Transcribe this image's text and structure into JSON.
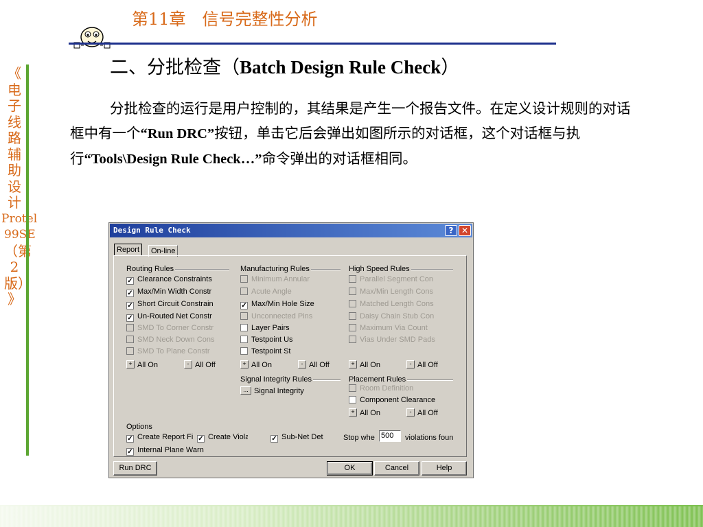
{
  "slide": {
    "chapter_title": "第11章　信号完整性分析",
    "side_title": [
      "《",
      "电",
      "子",
      "线",
      "路",
      "辅",
      "助",
      "设",
      "计",
      "Protel",
      "99SE",
      "（第",
      "2",
      "版）",
      "》"
    ],
    "heading_prefix": "二、分批检查（",
    "heading_en": "Batch Design Rule Check",
    "heading_suffix": "）",
    "para": {
      "p1": "分批检查的运行是用户控制的，其结果是产生一个报告文件。在定义设计规则的对话框中有一个",
      "q1": "“Run DRC”",
      "p2": "按钮，单击它后会弹出如图所示的对话框，这个对话框与执行",
      "q2": "“Tools\\Design Rule Check…”",
      "p3": "命令弹出的对话框相同。"
    }
  },
  "dialog": {
    "title": "Design Rule Check",
    "help_glyph": "?",
    "close_glyph": "✕",
    "tabs": [
      "Report",
      "On-line"
    ],
    "routing": {
      "label": "Routing Rules",
      "items": [
        {
          "label": "Clearance Constraints",
          "checked": true,
          "enabled": true
        },
        {
          "label": "Max/Min Width Constr",
          "checked": true,
          "enabled": true
        },
        {
          "label": "Short Circuit Constrain",
          "checked": true,
          "enabled": true
        },
        {
          "label": "Un-Routed Net Constr",
          "checked": true,
          "enabled": true
        },
        {
          "label": "SMD To Corner Constr",
          "checked": false,
          "enabled": false
        },
        {
          "label": "SMD Neck Down Cons",
          "checked": false,
          "enabled": false
        },
        {
          "label": "SMD To Plane Constr",
          "checked": false,
          "enabled": false
        }
      ]
    },
    "manufacturing": {
      "label": "Manufacturing Rules",
      "items": [
        {
          "label": "Minimum Annular",
          "checked": false,
          "enabled": false
        },
        {
          "label": "Acute Angle",
          "checked": false,
          "enabled": false
        },
        {
          "label": "Max/Min Hole Size",
          "checked": true,
          "enabled": true
        },
        {
          "label": "Unconnected Pins",
          "checked": false,
          "enabled": false
        },
        {
          "label": "Layer Pairs",
          "checked": false,
          "enabled": true
        },
        {
          "label": "Testpoint Us",
          "checked": false,
          "enabled": true
        },
        {
          "label": "Testpoint St",
          "checked": false,
          "enabled": true
        }
      ]
    },
    "high_speed": {
      "label": "High Speed Rules",
      "items": [
        {
          "label": "Parallel Segment Con",
          "checked": false,
          "enabled": false
        },
        {
          "label": "Max/Min Length Cons",
          "checked": false,
          "enabled": false
        },
        {
          "label": "Matched Length Cons",
          "checked": false,
          "enabled": false
        },
        {
          "label": "Daisy Chain Stub Con",
          "checked": false,
          "enabled": false
        },
        {
          "label": "Maximum Via Count",
          "checked": false,
          "enabled": false
        },
        {
          "label": "Vias Under SMD Pads",
          "checked": false,
          "enabled": false
        }
      ]
    },
    "signal_integrity": {
      "label": "Signal Integrity Rules",
      "button_glyph": "...",
      "button_label": "Signal Integrity"
    },
    "placement": {
      "label": "Placement Rules",
      "items": [
        {
          "label": "Room Definition",
          "checked": false,
          "enabled": false
        },
        {
          "label": "Component Clearance",
          "checked": false,
          "enabled": true
        }
      ]
    },
    "all_on": "All On",
    "all_off": "All Off",
    "all_on_glyph": "+",
    "all_off_glyph": "-",
    "options": {
      "label": "Options",
      "create_report": "Create Report Fi",
      "create_violations": "Create Violati",
      "subnet": "Sub-Net Det",
      "stop_when": "Stop whe",
      "stop_value": "500",
      "violations_found": "violations foun",
      "internal_plane": "Internal Plane Warn"
    },
    "buttons": {
      "run_drc": "Run DRC",
      "ok": "OK",
      "cancel": "Cancel",
      "help": "Help"
    }
  }
}
